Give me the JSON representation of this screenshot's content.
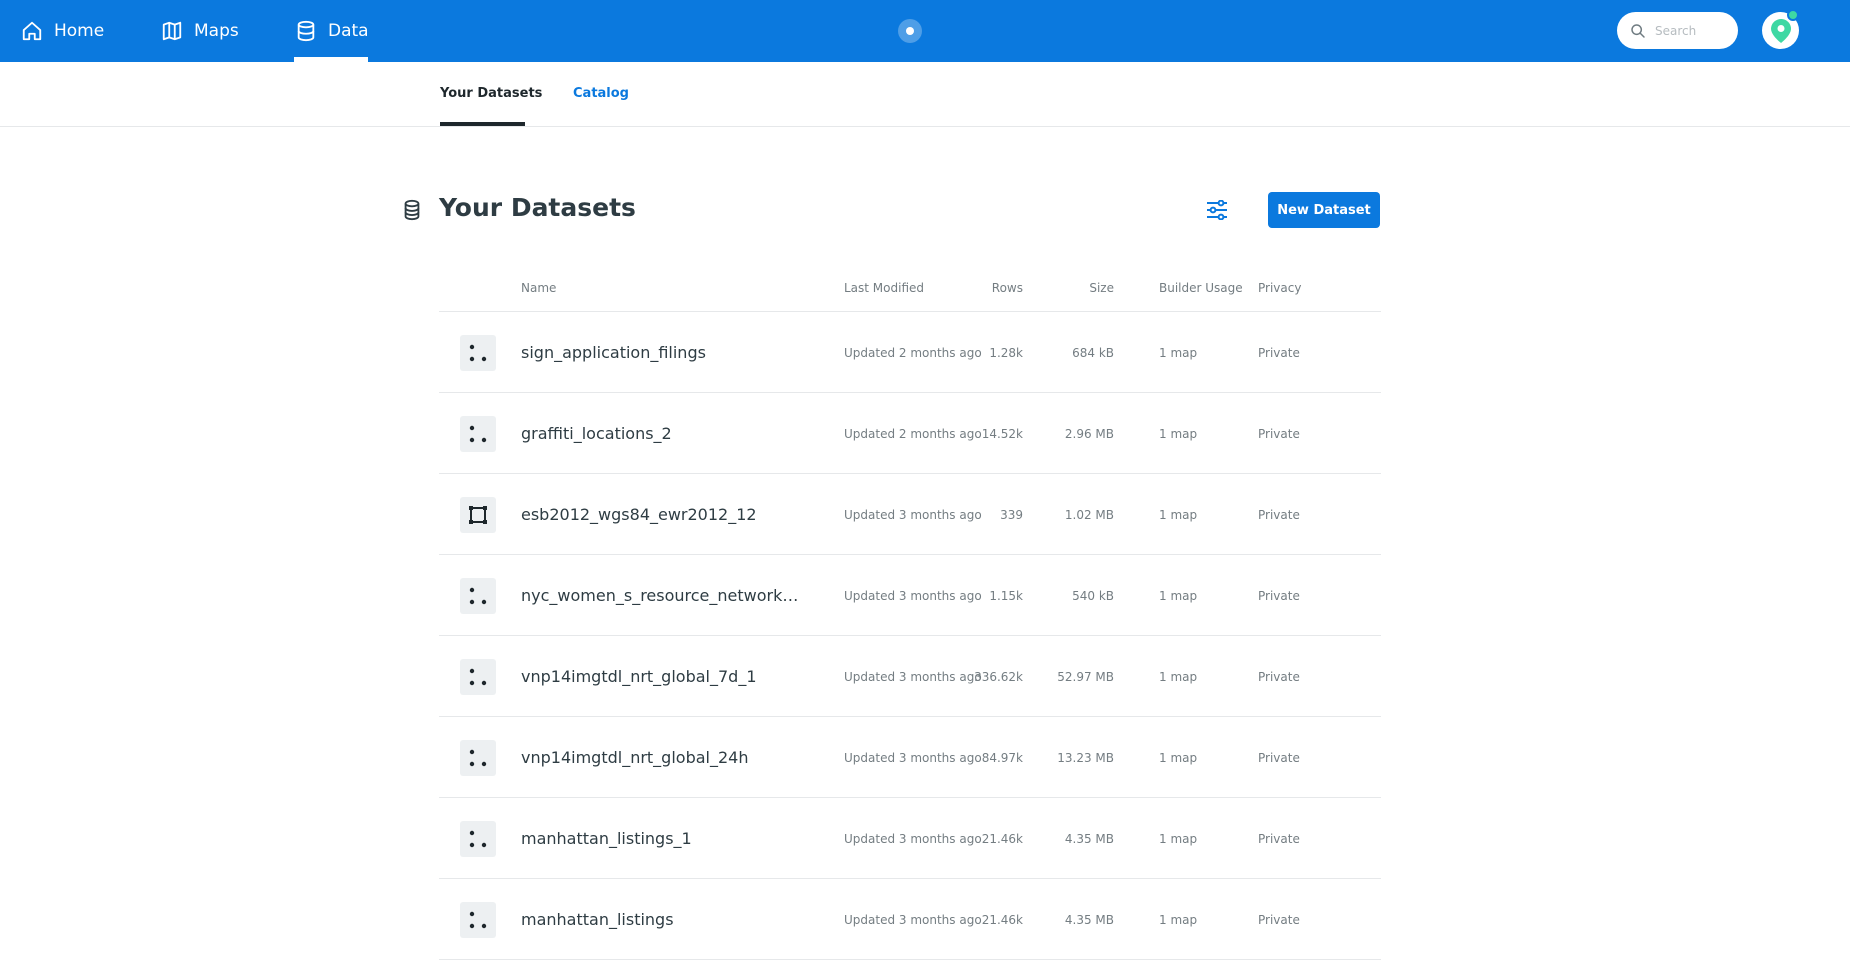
{
  "nav": {
    "home": "Home",
    "maps": "Maps",
    "data": "Data"
  },
  "search": {
    "placeholder": "Search"
  },
  "subnav": {
    "tabs": [
      "Your Datasets",
      "Catalog"
    ],
    "active": "Your Datasets"
  },
  "page": {
    "title": "Your Datasets",
    "new_button": "New Dataset"
  },
  "table": {
    "columns": [
      "Name",
      "Last Modified",
      "Rows",
      "Size",
      "Builder Usage",
      "Privacy"
    ],
    "rows": [
      {
        "type_icon": "points-icon",
        "name": "sign_application_filings",
        "modified": "Updated 2 months ago",
        "rows": "1.28k",
        "size": "684 kB",
        "usage": "1 map",
        "privacy": "Private"
      },
      {
        "type_icon": "points-icon",
        "name": "graffiti_locations_2",
        "modified": "Updated 2 months ago",
        "rows": "14.52k",
        "size": "2.96 MB",
        "usage": "1 map",
        "privacy": "Private"
      },
      {
        "type_icon": "polygon-icon",
        "name": "esb2012_wgs84_ewr2012_12",
        "modified": "Updated 3 months ago",
        "rows": "339",
        "size": "1.02 MB",
        "usage": "1 map",
        "privacy": "Private"
      },
      {
        "type_icon": "points-icon",
        "name": "nyc_women_s_resource_network_d...",
        "modified": "Updated 3 months ago",
        "rows": "1.15k",
        "size": "540 kB",
        "usage": "1 map",
        "privacy": "Private"
      },
      {
        "type_icon": "points-icon",
        "name": "vnp14imgtdl_nrt_global_7d_1",
        "modified": "Updated 3 months ago",
        "rows": "336.62k",
        "size": "52.97 MB",
        "usage": "1 map",
        "privacy": "Private"
      },
      {
        "type_icon": "points-icon",
        "name": "vnp14imgtdl_nrt_global_24h",
        "modified": "Updated 3 months ago",
        "rows": "84.97k",
        "size": "13.23 MB",
        "usage": "1 map",
        "privacy": "Private"
      },
      {
        "type_icon": "points-icon",
        "name": "manhattan_listings_1",
        "modified": "Updated 3 months ago",
        "rows": "21.46k",
        "size": "4.35 MB",
        "usage": "1 map",
        "privacy": "Private"
      },
      {
        "type_icon": "points-icon",
        "name": "manhattan_listings",
        "modified": "Updated 3 months ago",
        "rows": "21.46k",
        "size": "4.35 MB",
        "usage": "1 map",
        "privacy": "Private"
      }
    ]
  },
  "colors": {
    "brand": "#0b79de",
    "badge": "#3ed8a3",
    "logo_pin": "#3ed8a3"
  }
}
